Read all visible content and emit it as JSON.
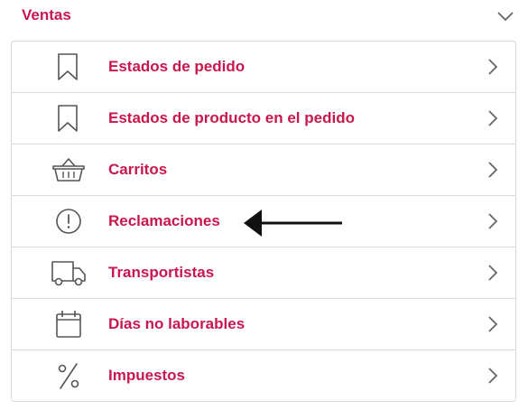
{
  "section": {
    "title": "Ventas",
    "collapse_icon": "chevron-down-icon"
  },
  "menu": {
    "items": [
      {
        "label": "Estados de pedido",
        "icon": "bookmark-icon"
      },
      {
        "label": "Estados de producto en el pedido",
        "icon": "bookmark-icon"
      },
      {
        "label": "Carritos",
        "icon": "basket-icon"
      },
      {
        "label": "Reclamaciones",
        "icon": "alert-circle-icon"
      },
      {
        "label": "Transportistas",
        "icon": "truck-icon"
      },
      {
        "label": "Días no laborables",
        "icon": "calendar-icon"
      },
      {
        "label": "Impuestos",
        "icon": "percent-icon"
      }
    ],
    "item_chevron_icon": "chevron-right-icon"
  },
  "colors": {
    "accent": "#c8174e",
    "icon": "#555555",
    "border": "#d9d9d9"
  }
}
